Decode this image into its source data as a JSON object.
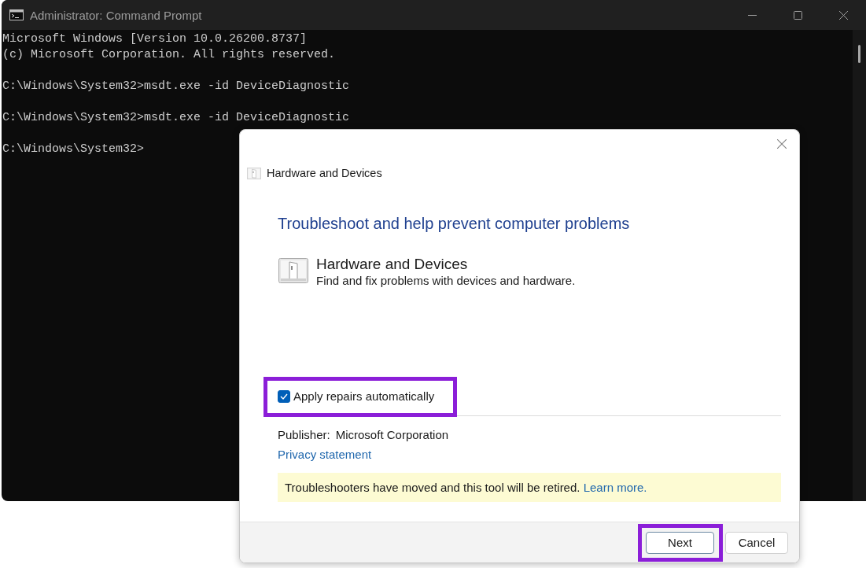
{
  "console_window": {
    "title": "Administrator: Command Prompt",
    "output_blocks": [
      [
        "Microsoft Windows [Version 10.0.26200.8737]",
        "(c) Microsoft Corporation. All rights reserved."
      ],
      [
        "C:\\Windows\\System32>msdt.exe -id DeviceDiagnostic"
      ],
      [
        "C:\\Windows\\System32>msdt.exe -id DeviceDiagnostic"
      ],
      [
        "C:\\Windows\\System32>"
      ]
    ]
  },
  "dialog": {
    "title": "Hardware and Devices",
    "heading": "Troubleshoot and help prevent computer problems",
    "troubleshooter": {
      "name": "Hardware and Devices",
      "description": "Find and fix problems with devices and hardware."
    },
    "auto_repair": {
      "label": "Apply repairs automatically",
      "checked": true,
      "highlighted": true
    },
    "publisher": {
      "label": "Publisher:",
      "value": "Microsoft Corporation"
    },
    "privacy_link": "Privacy statement",
    "notice": {
      "text": "Troubleshooters have moved and this tool will be retired.",
      "link": "Learn more."
    },
    "buttons": [
      {
        "label": "Next",
        "kind": "default",
        "highlighted": true
      },
      {
        "label": "Cancel",
        "kind": "normal",
        "highlighted": false
      }
    ]
  }
}
